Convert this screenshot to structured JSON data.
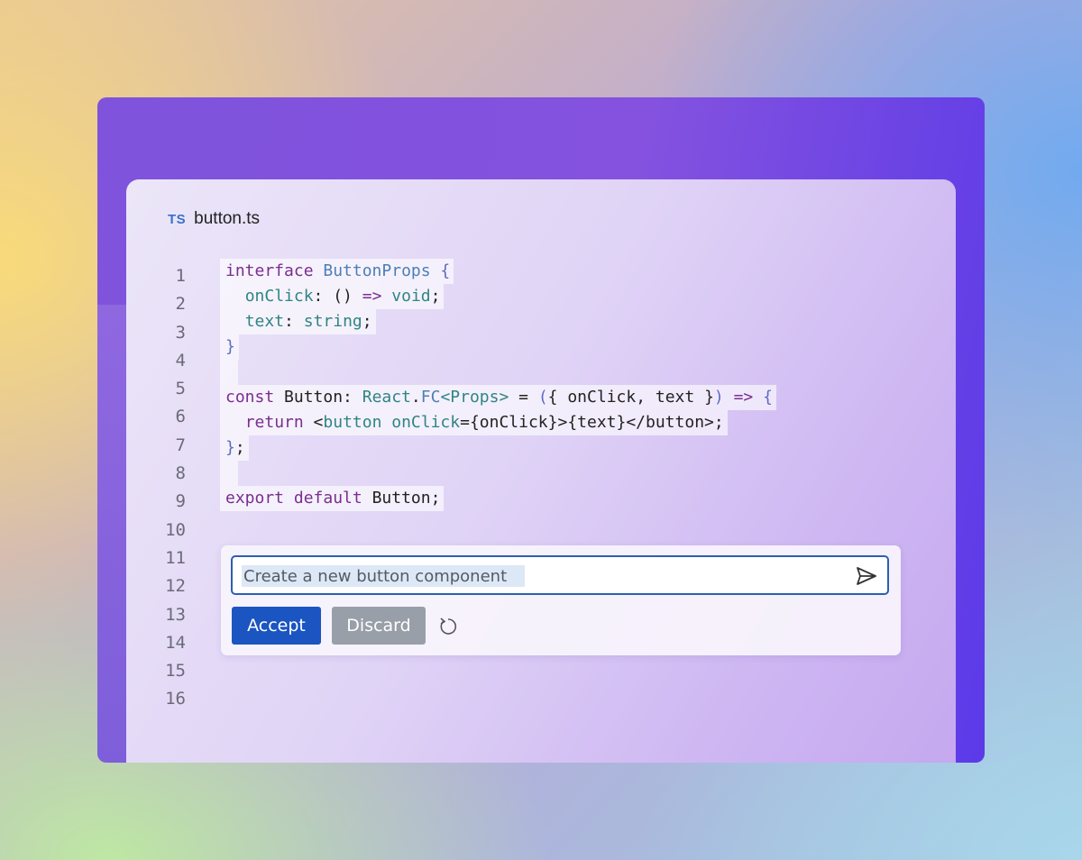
{
  "tab": {
    "badge": "TS",
    "filename": "button.ts"
  },
  "line_numbers": [
    "1",
    "2",
    "3",
    "4",
    "5",
    "6",
    "7",
    "8",
    "9",
    "10",
    "11",
    "12",
    "13",
    "14",
    "15",
    "16"
  ],
  "code_lines": [
    [
      [
        "kw",
        "interface "
      ],
      [
        "ty",
        "ButtonProps "
      ],
      [
        "pu",
        "{"
      ]
    ],
    [
      [
        "pl",
        "  "
      ],
      [
        "pr",
        "onClick"
      ],
      [
        "pl",
        ": () "
      ],
      [
        "kw",
        "=>"
      ],
      [
        "pl",
        " "
      ],
      [
        "pr",
        "void"
      ],
      [
        "pl",
        ";"
      ]
    ],
    [
      [
        "pl",
        "  "
      ],
      [
        "pr",
        "text"
      ],
      [
        "pl",
        ": "
      ],
      [
        "pr",
        "string"
      ],
      [
        "pl",
        ";"
      ]
    ],
    [
      [
        "pu",
        "}"
      ]
    ],
    [],
    [
      [
        "kw",
        "const "
      ],
      [
        "pl",
        "Button: "
      ],
      [
        "pr",
        "React"
      ],
      [
        "pl",
        "."
      ],
      [
        "ty",
        "FC"
      ],
      [
        "pr",
        "<Props>"
      ],
      [
        "pl",
        " = "
      ],
      [
        "pu",
        "("
      ],
      [
        "pl",
        "{ onClick, text }"
      ],
      [
        "pu",
        ")"
      ],
      [
        "pl",
        " "
      ],
      [
        "kw",
        "=>"
      ],
      [
        "pl",
        " "
      ],
      [
        "pu",
        "{"
      ]
    ],
    [
      [
        "pl",
        "  "
      ],
      [
        "kw",
        "return "
      ],
      [
        "pl",
        "<"
      ],
      [
        "pr",
        "button "
      ],
      [
        "pr",
        "onClick"
      ],
      [
        "pl",
        "={onClick}>{text}</button>;"
      ]
    ],
    [
      [
        "pu",
        "}"
      ],
      [
        "pl",
        ";"
      ]
    ],
    [],
    [
      [
        "kw",
        "export default "
      ],
      [
        "pl",
        "Button;"
      ]
    ]
  ],
  "assistant": {
    "prompt_value": "Create a new button component",
    "accept_label": "Accept",
    "discard_label": "Discard"
  },
  "icons": {
    "send": "send-icon",
    "retry": "refresh-icon"
  },
  "colors": {
    "accept": "#1b55c2",
    "discard": "#999fa8",
    "keyword": "#7a2e8e",
    "type": "#4c7fb5",
    "property": "#2e8583"
  }
}
